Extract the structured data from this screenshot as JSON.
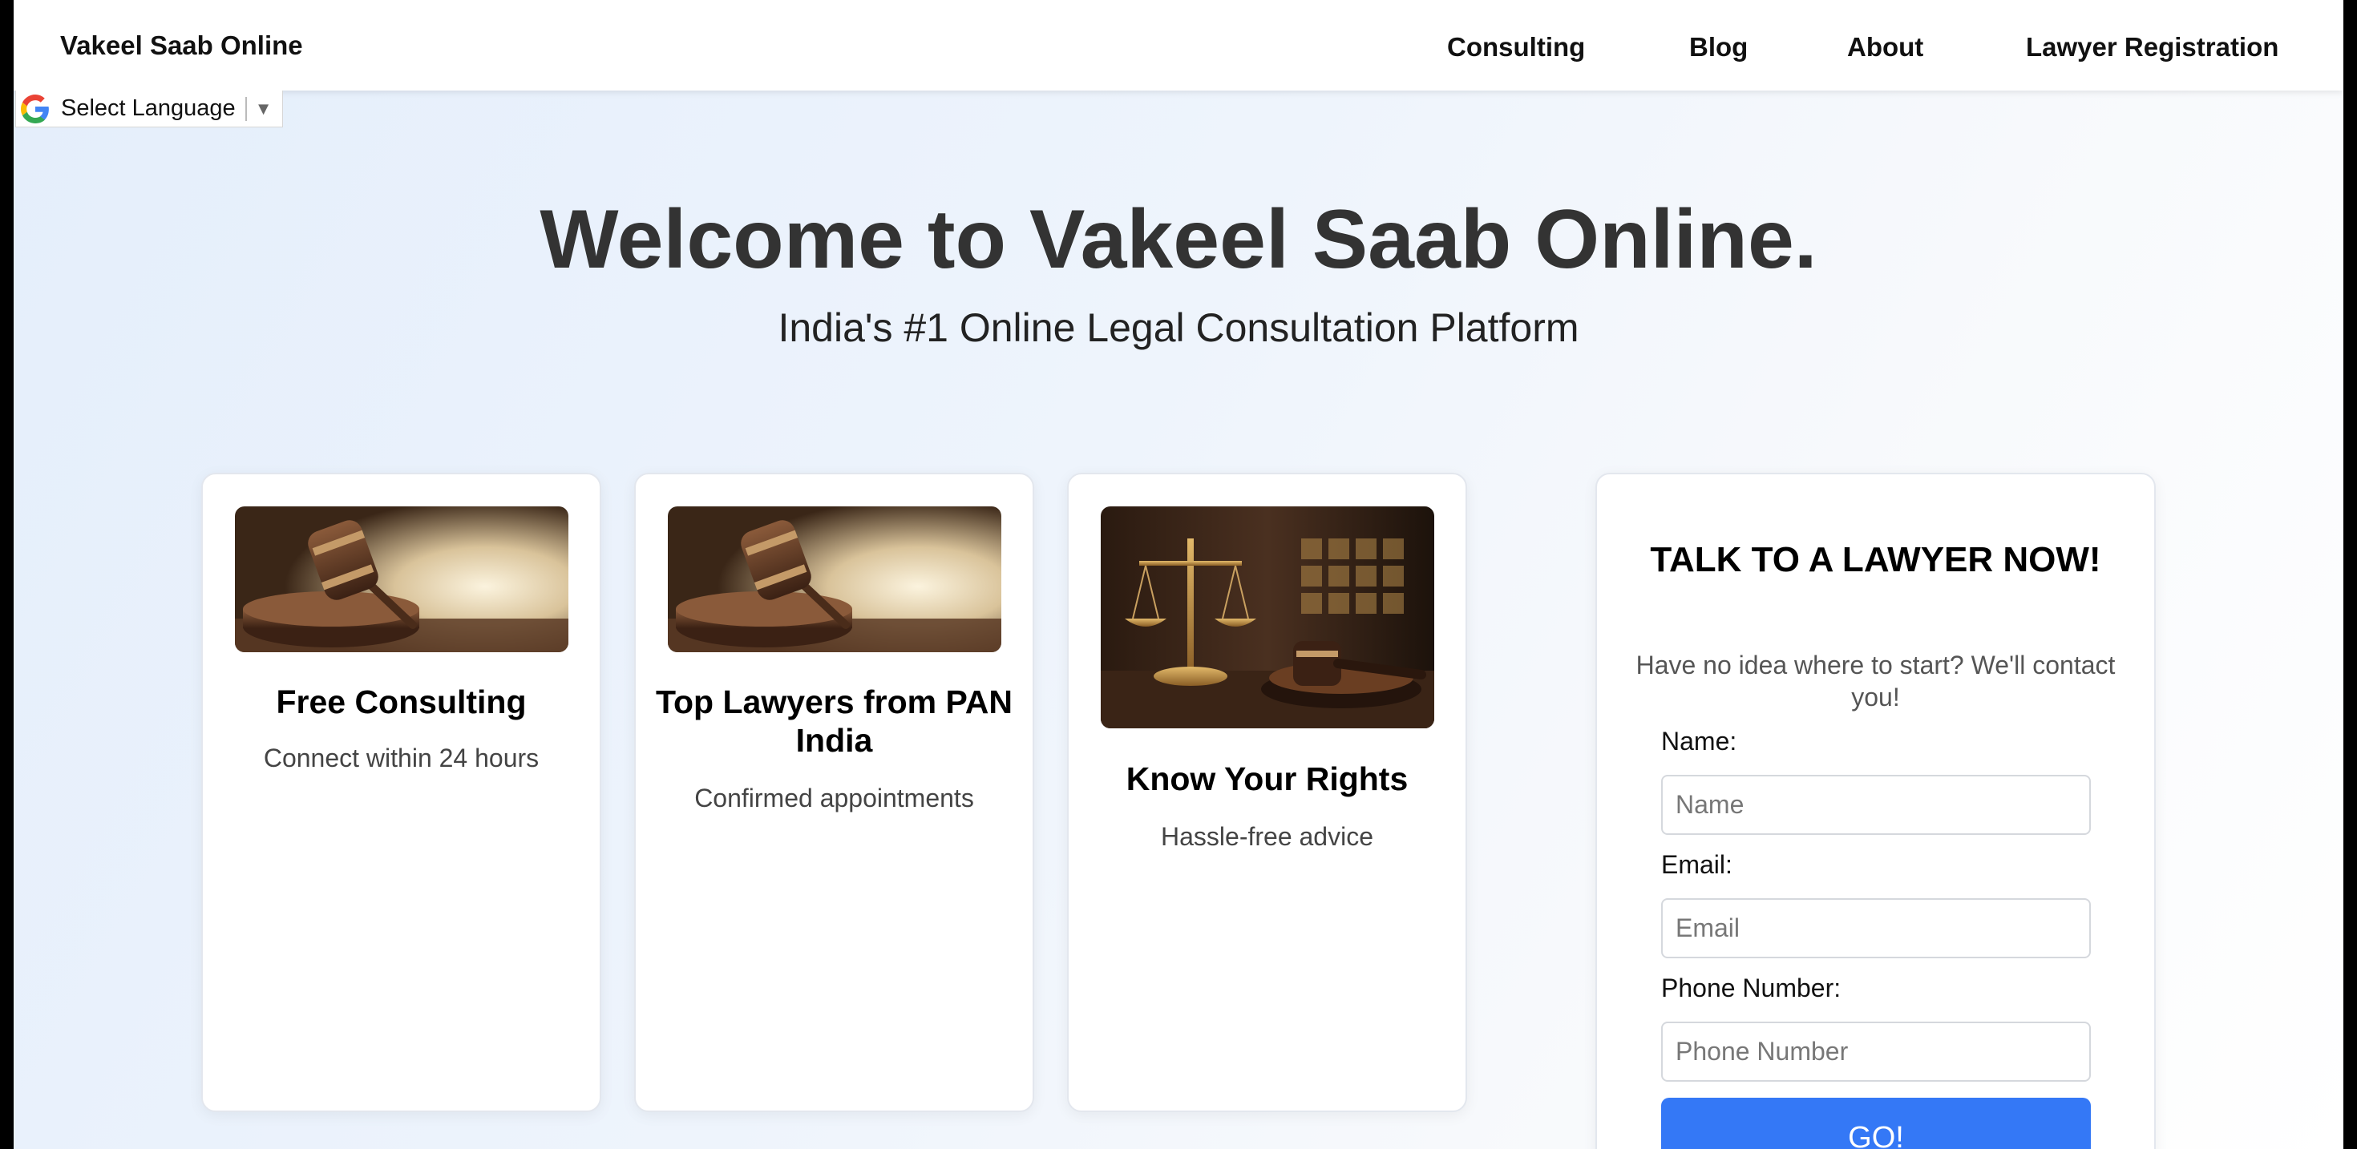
{
  "navbar": {
    "brand": "Vakeel Saab Online",
    "links": [
      {
        "label": "Consulting"
      },
      {
        "label": "Blog"
      },
      {
        "label": "About"
      },
      {
        "label": "Lawyer Registration"
      }
    ]
  },
  "language_selector": {
    "label": "Select Language",
    "icon": "google-g-icon"
  },
  "hero": {
    "title": "Welcome to Vakeel Saab Online.",
    "subtitle": "India's #1 Online Legal Consultation Platform"
  },
  "features": [
    {
      "title": "Free Consulting",
      "description": "Connect within 24 hours",
      "image": "gavel-image"
    },
    {
      "title": "Top Lawyers from PAN India",
      "description": "Confirmed appointments",
      "image": "gavel-image"
    },
    {
      "title": "Know Your Rights",
      "description": "Hassle-free advice",
      "image": "scales-of-justice-image"
    }
  ],
  "contact_form": {
    "title": "TALK TO A LAWYER NOW!",
    "subtitle": "Have no idea where to start? We'll contact you!",
    "fields": [
      {
        "label": "Name:",
        "placeholder": "Name",
        "value": ""
      },
      {
        "label": "Email:",
        "placeholder": "Email",
        "value": ""
      },
      {
        "label": "Phone Number:",
        "placeholder": "Phone Number",
        "value": ""
      }
    ],
    "submit_label": "GO!"
  },
  "colors": {
    "primary_button": "#3478f6",
    "heading": "#333333",
    "background_tint": "#e4eefb"
  }
}
